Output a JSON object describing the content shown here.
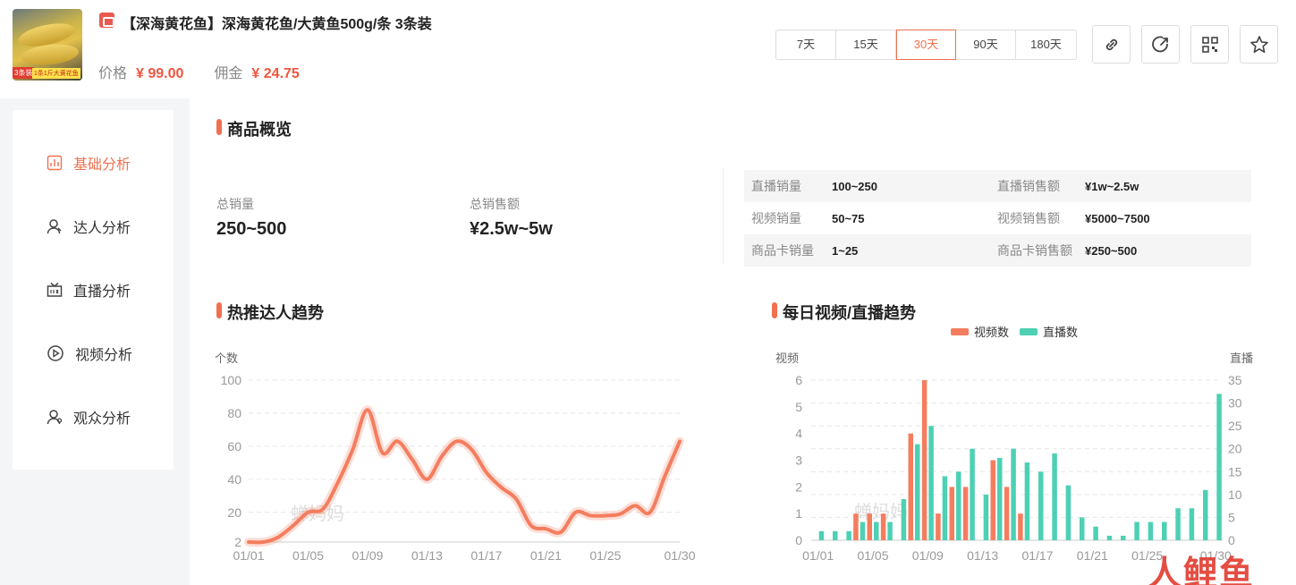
{
  "product": {
    "title": "【深海黄花鱼】深海黄花鱼/大黄鱼500g/条 3条装",
    "thumb_tag1": "3条装",
    "thumb_tag2": "1条1斤大黄花鱼",
    "price_label": "价格",
    "price_value": "¥ 99.00",
    "commission_label": "佣金",
    "commission_value": "¥ 24.75"
  },
  "date_ranges": [
    {
      "label": "7天",
      "active": false
    },
    {
      "label": "15天",
      "active": false
    },
    {
      "label": "30天",
      "active": true
    },
    {
      "label": "90天",
      "active": false
    },
    {
      "label": "180天",
      "active": false
    }
  ],
  "actions": [
    "link-icon",
    "share-icon",
    "qrcode-icon",
    "star-icon"
  ],
  "sidebar": {
    "items": [
      {
        "label": "基础分析",
        "icon": "bar-chart-icon",
        "active": true
      },
      {
        "label": "达人分析",
        "icon": "user-icon",
        "active": false
      },
      {
        "label": "直播分析",
        "icon": "live-icon",
        "active": false
      },
      {
        "label": "视频分析",
        "icon": "play-icon",
        "active": false
      },
      {
        "label": "观众分析",
        "icon": "audience-icon",
        "active": false
      }
    ]
  },
  "overview": {
    "title": "商品概览",
    "total_sales_label": "总销量",
    "total_sales_value": "250~500",
    "total_amount_label": "总销售额",
    "total_amount_value": "¥2.5w~5w",
    "table": [
      {
        "k1": "直播销量",
        "v1": "100~250",
        "k2": "直播销售额",
        "v2": "¥1w~2.5w"
      },
      {
        "k1": "视频销量",
        "v1": "50~75",
        "k2": "视频销售额",
        "v2": "¥5000~7500"
      },
      {
        "k1": "商品卡销量",
        "v1": "1~25",
        "k2": "商品卡销售额",
        "v2": "¥250~500"
      }
    ]
  },
  "trend_title": "热推达人趋势",
  "daily_title": "每日视频/直播趋势",
  "watermark": "蝉妈妈",
  "corner_logo": "人鲤鱼",
  "colors": {
    "accent": "#f0704f",
    "video": "#f47d5e",
    "live": "#4dd0b4"
  },
  "chart_data": [
    {
      "type": "line",
      "title": "热推达人趋势",
      "ylabel": "个数",
      "ylim": [
        2,
        100
      ],
      "y_ticks": [
        2,
        20,
        40,
        60,
        80,
        100
      ],
      "x_ticks": [
        "01/01",
        "01/05",
        "01/09",
        "01/13",
        "01/17",
        "01/21",
        "01/25",
        "01/30"
      ],
      "x": [
        "01/01",
        "01/02",
        "01/03",
        "01/04",
        "01/05",
        "01/06",
        "01/07",
        "01/08",
        "01/09",
        "01/10",
        "01/11",
        "01/12",
        "01/13",
        "01/14",
        "01/15",
        "01/16",
        "01/17",
        "01/18",
        "01/19",
        "01/20",
        "01/21",
        "01/22",
        "01/23",
        "01/24",
        "01/25",
        "01/26",
        "01/27",
        "01/28",
        "01/29",
        "01/30"
      ],
      "values": [
        2,
        2,
        5,
        12,
        20,
        22,
        38,
        58,
        82,
        56,
        63,
        52,
        40,
        54,
        63,
        58,
        44,
        35,
        28,
        12,
        10,
        8,
        20,
        18,
        18,
        19,
        24,
        20,
        42,
        63
      ],
      "color": "#f47d5e",
      "grid": true
    },
    {
      "type": "bar",
      "title": "每日视频/直播趋势",
      "ylabel_left": "视频",
      "ylabel_right": "直播",
      "ylim_left": [
        0,
        6
      ],
      "ylim_right": [
        0,
        35
      ],
      "y_ticks_left": [
        0,
        1,
        2,
        3,
        4,
        5,
        6
      ],
      "y_ticks_right": [
        0,
        5,
        10,
        15,
        20,
        25,
        30,
        35
      ],
      "x_ticks": [
        "01/01",
        "01/05",
        "01/09",
        "01/13",
        "01/17",
        "01/21",
        "01/25",
        "01/30"
      ],
      "categories": [
        "01/01",
        "01/02",
        "01/03",
        "01/04",
        "01/05",
        "01/06",
        "01/07",
        "01/08",
        "01/09",
        "01/10",
        "01/11",
        "01/12",
        "01/13",
        "01/14",
        "01/15",
        "01/16",
        "01/17",
        "01/18",
        "01/19",
        "01/20",
        "01/21",
        "01/22",
        "01/23",
        "01/24",
        "01/25",
        "01/26",
        "01/27",
        "01/28",
        "01/29",
        "01/30"
      ],
      "series": [
        {
          "name": "视频数",
          "axis": "left",
          "color": "#f47d5e",
          "values": [
            0,
            0,
            0,
            1,
            1,
            1,
            0,
            4,
            6,
            1,
            2,
            2,
            0,
            3,
            2,
            1,
            0,
            0,
            0,
            0,
            0,
            0,
            0,
            0,
            0,
            0,
            0,
            0,
            0,
            0
          ]
        },
        {
          "name": "直播数",
          "axis": "right",
          "color": "#4dd0b4",
          "values": [
            2,
            2,
            2,
            4,
            4,
            4,
            9,
            21,
            25,
            14,
            15,
            20,
            10,
            18,
            20,
            17,
            15,
            19,
            12,
            5,
            3,
            1,
            1,
            4,
            4,
            4,
            7,
            7,
            11,
            32
          ]
        }
      ],
      "legend": "top-center",
      "grid": true
    }
  ]
}
